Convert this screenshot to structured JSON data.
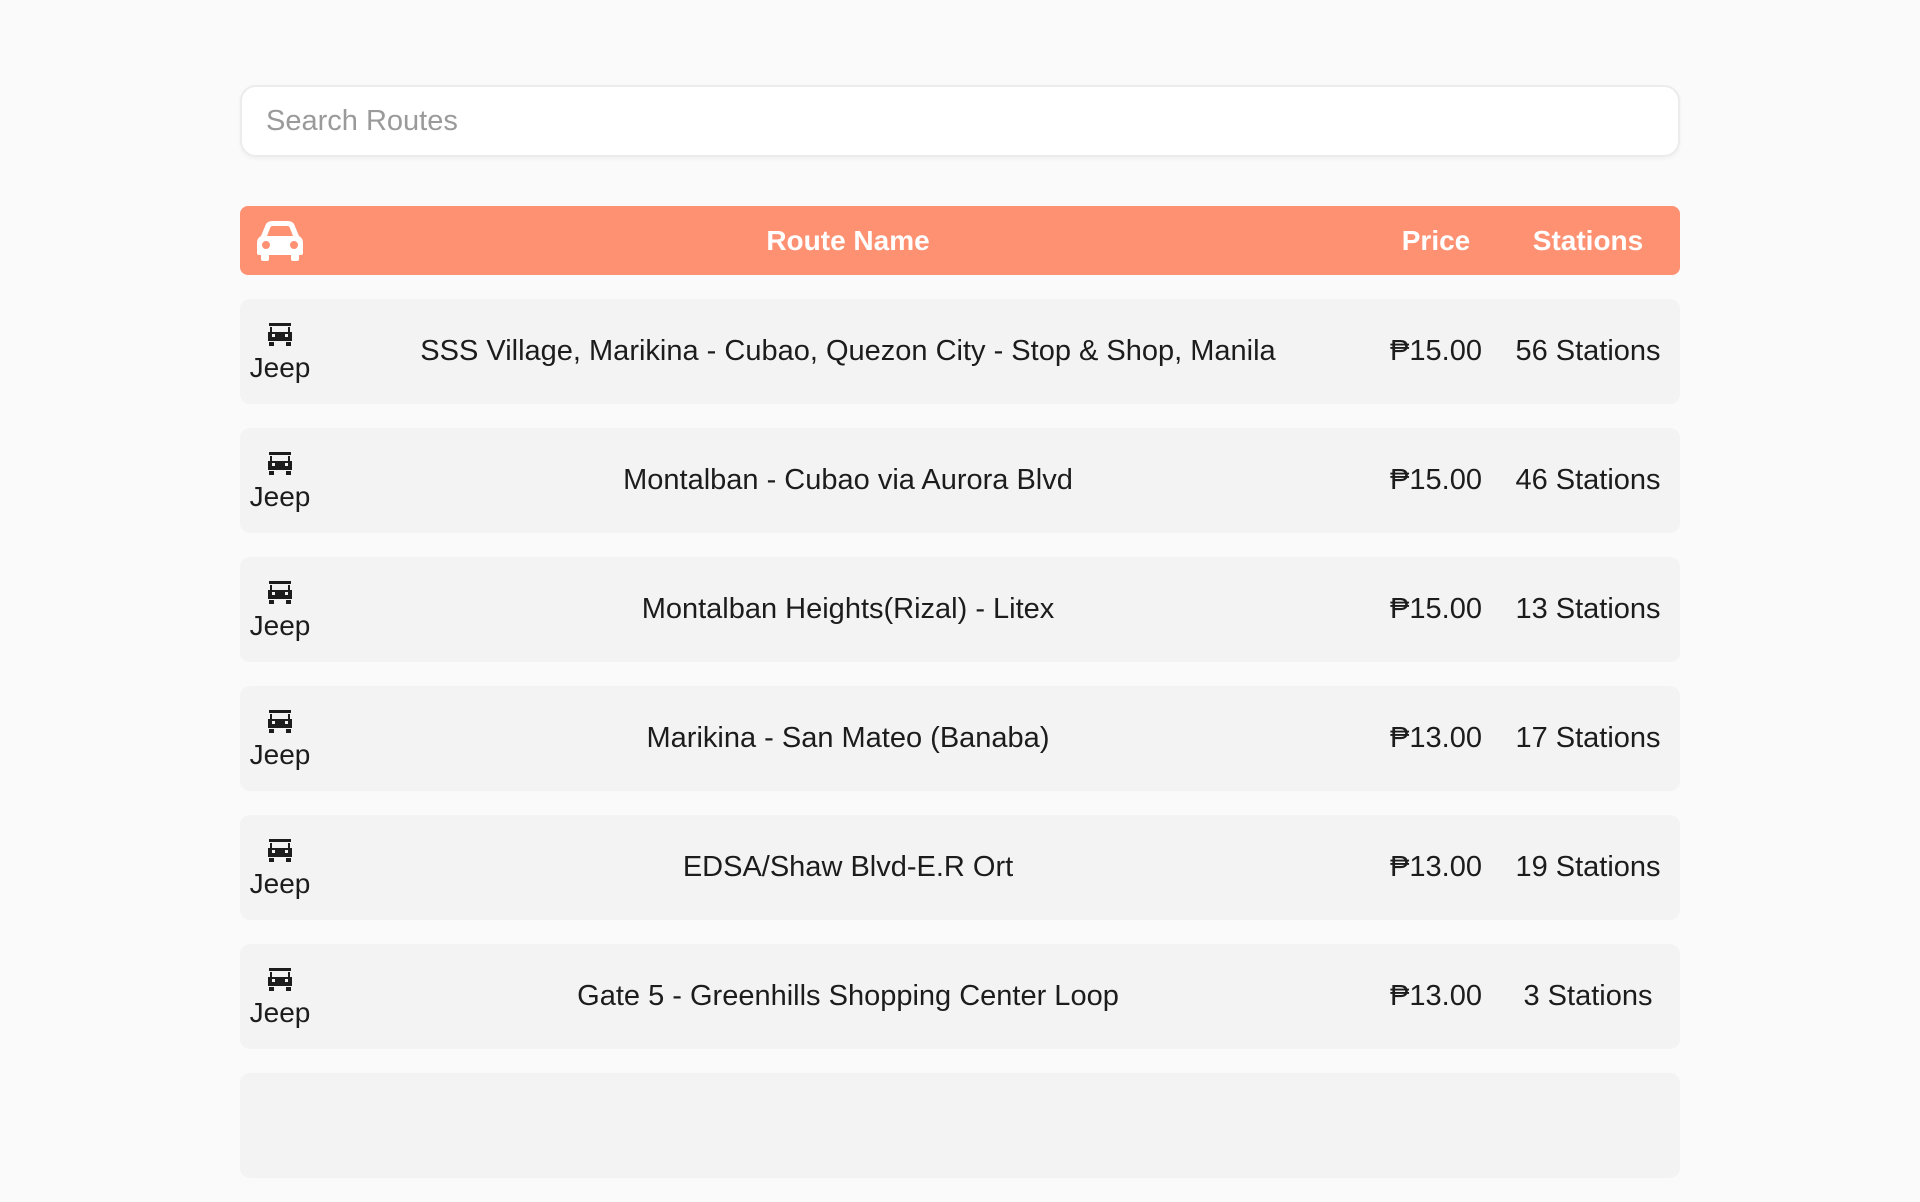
{
  "search": {
    "placeholder": "Search Routes",
    "value": ""
  },
  "header": {
    "icon": "car-icon",
    "route_name_label": "Route Name",
    "price_label": "Price",
    "stations_label": "Stations"
  },
  "colors": {
    "accent": "#ff9173",
    "row_background": "#f3f3f3",
    "page_background": "#fafafa"
  },
  "routes": [
    {
      "type": "Jeep",
      "icon": "jeep-icon",
      "name": "SSS Village, Marikina - Cubao, Quezon City - Stop & Shop, Manila",
      "price": "₱15.00",
      "stations": "56 Stations"
    },
    {
      "type": "Jeep",
      "icon": "jeep-icon",
      "name": "Montalban - Cubao via Aurora Blvd",
      "price": "₱15.00",
      "stations": "46 Stations"
    },
    {
      "type": "Jeep",
      "icon": "jeep-icon",
      "name": "Montalban Heights(Rizal) - Litex",
      "price": "₱15.00",
      "stations": "13 Stations"
    },
    {
      "type": "Jeep",
      "icon": "jeep-icon",
      "name": "Marikina - San Mateo (Banaba)",
      "price": "₱13.00",
      "stations": "17 Stations"
    },
    {
      "type": "Jeep",
      "icon": "jeep-icon",
      "name": "EDSA/Shaw Blvd-E.R Ort",
      "price": "₱13.00",
      "stations": "19 Stations"
    },
    {
      "type": "Jeep",
      "icon": "jeep-icon",
      "name": "Gate 5 - Greenhills Shopping Center Loop",
      "price": "₱13.00",
      "stations": "3 Stations"
    }
  ]
}
